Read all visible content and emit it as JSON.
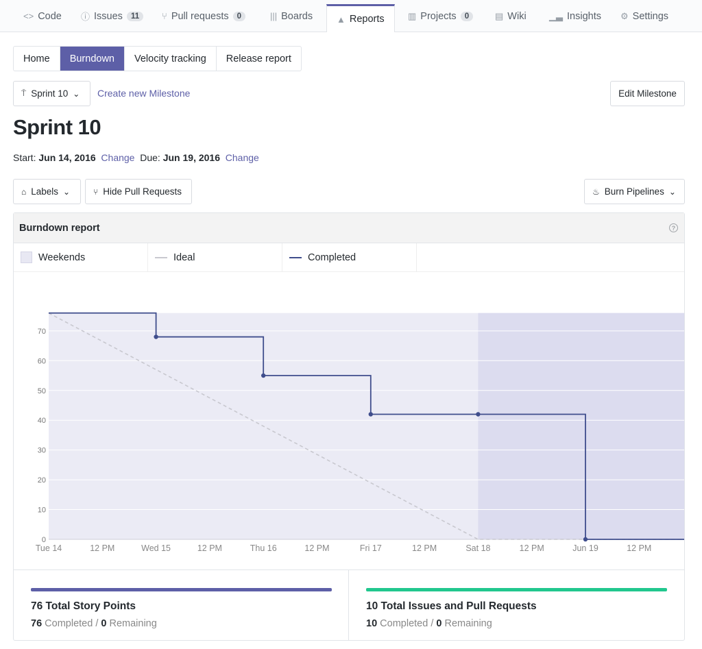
{
  "repo_nav": {
    "tabs": [
      {
        "label": "Code",
        "icon": "code-icon"
      },
      {
        "label": "Issues",
        "icon": "issue-icon",
        "count": "11"
      },
      {
        "label": "Pull requests",
        "icon": "pull-request-icon",
        "count": "0"
      },
      {
        "label": "Boards",
        "icon": "boards-icon"
      },
      {
        "label": "Reports",
        "icon": "graph-icon",
        "active": true
      },
      {
        "label": "Projects",
        "icon": "project-icon",
        "count": "0"
      },
      {
        "label": "Wiki",
        "icon": "book-icon"
      },
      {
        "label": "Insights",
        "icon": "insights-icon"
      },
      {
        "label": "Settings",
        "icon": "gear-icon"
      }
    ]
  },
  "subnav": {
    "items": [
      "Home",
      "Burndown",
      "Velocity tracking",
      "Release report"
    ],
    "active": "Burndown"
  },
  "milestone": {
    "selected": "Sprint 10",
    "create_link": "Create new Milestone",
    "edit_label": "Edit Milestone"
  },
  "page_title": "Sprint 10",
  "dates": {
    "start_label": "Start:",
    "start": "Jun 14, 2016",
    "due_label": "Due:",
    "due": "Jun 19, 2016",
    "change_label": "Change"
  },
  "filters": {
    "labels_label": "Labels",
    "hide_pr_label": "Hide Pull Requests",
    "burn_pipelines_label": "Burn Pipelines"
  },
  "report": {
    "title": "Burndown report",
    "legend": [
      "Weekends",
      "Ideal",
      "Completed"
    ]
  },
  "colors": {
    "accent": "#5d5fa7",
    "completed_line": "#3f4d8c",
    "ideal_line": "#c8c8cf",
    "weekend_fill": "#dcdcef",
    "area_fill": "#ebebf5",
    "issues_bar": "#21c78e"
  },
  "chart_data": {
    "type": "line",
    "x_ticks": [
      "Tue 14",
      "12 PM",
      "Wed 15",
      "12 PM",
      "Thu 16",
      "12 PM",
      "Fri 17",
      "12 PM",
      "Sat 18",
      "12 PM",
      "Jun 19",
      "12 PM"
    ],
    "y_ticks": [
      0,
      10,
      20,
      30,
      40,
      50,
      60,
      70
    ],
    "ylim": [
      0,
      76
    ],
    "weekend_range": [
      "Sat 18",
      "Sun 19 end"
    ],
    "series": [
      {
        "name": "Ideal",
        "style": "dashed",
        "points": [
          [
            "Tue 14",
            76
          ],
          [
            "Sat 18",
            0
          ],
          [
            "Jun 19 12 PM",
            0
          ]
        ]
      },
      {
        "name": "Completed",
        "style": "step",
        "points": [
          [
            "Tue 14",
            76
          ],
          [
            "Wed 15",
            68
          ],
          [
            "Thu 16",
            55
          ],
          [
            "Fri 17",
            42
          ],
          [
            "Sat 18",
            42
          ],
          [
            "Jun 19",
            0
          ],
          [
            "Jun 19 12 PM",
            0
          ]
        ]
      }
    ]
  },
  "stats": [
    {
      "title": "76 Total Story Points",
      "completed": "76",
      "completed_label": "Completed",
      "remaining": "0",
      "remaining_label": "Remaining"
    },
    {
      "title": "10 Total Issues and Pull Requests",
      "completed": "10",
      "completed_label": "Completed",
      "remaining": "0",
      "remaining_label": "Remaining"
    }
  ]
}
